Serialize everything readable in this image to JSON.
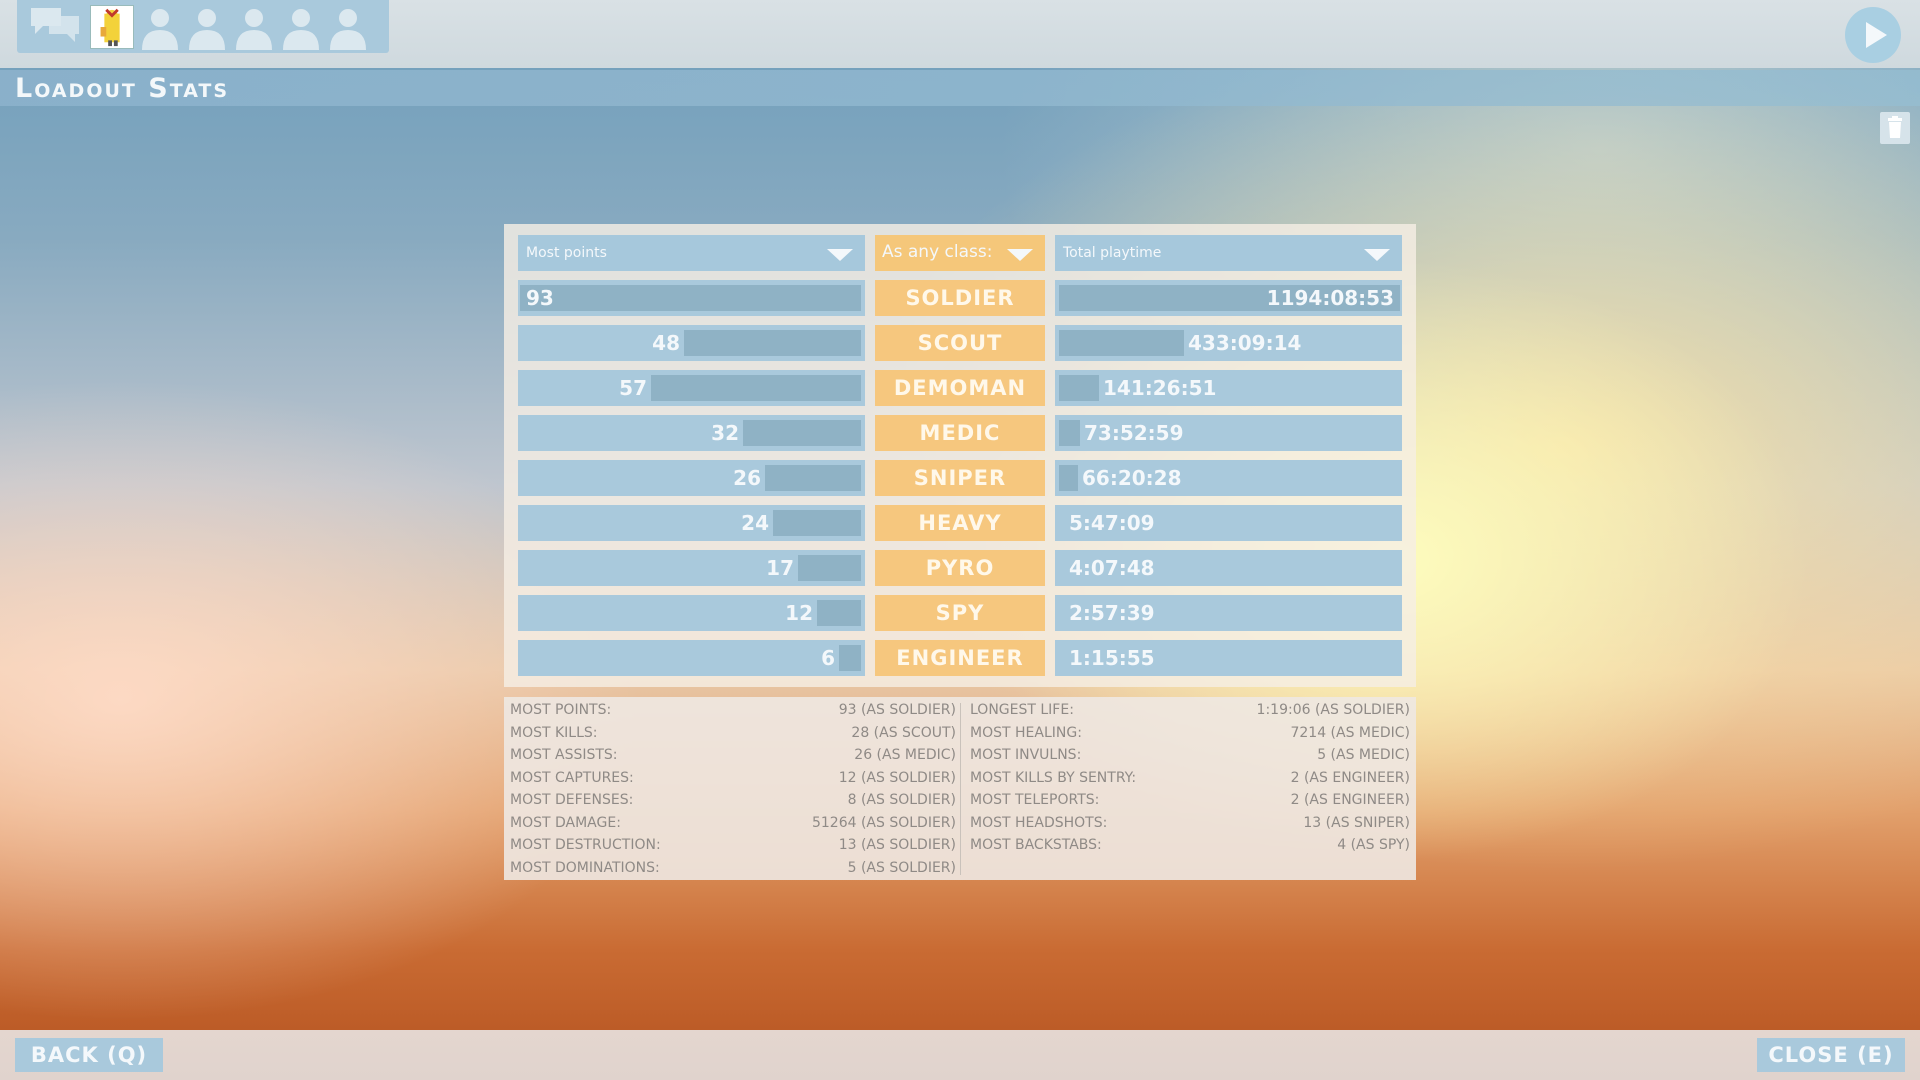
{
  "header": {
    "title": "Loadout Stats",
    "icons": [
      "chat-icon",
      "player-avatar",
      "empty-party-slot-icon",
      "play-icon",
      "trash-icon"
    ]
  },
  "filters": {
    "left_metric": "Most points",
    "class_filter": "As any class:",
    "right_metric": "Total playtime"
  },
  "classes": [
    {
      "name": "SOLDIER",
      "points": "93",
      "points_fraction": 1.0,
      "playtime": "1194:08:53",
      "playtime_fraction": 1.0
    },
    {
      "name": "SCOUT",
      "points": "48",
      "points_fraction": 0.516,
      "playtime": "433:09:14",
      "playtime_fraction": 0.363
    },
    {
      "name": "DEMOMAN",
      "points": "57",
      "points_fraction": 0.613,
      "playtime": "141:26:51",
      "playtime_fraction": 0.118
    },
    {
      "name": "MEDIC",
      "points": "32",
      "points_fraction": 0.344,
      "playtime": "73:52:59",
      "playtime_fraction": 0.062
    },
    {
      "name": "SNIPER",
      "points": "26",
      "points_fraction": 0.28,
      "playtime": "66:20:28",
      "playtime_fraction": 0.056
    },
    {
      "name": "HEAVY",
      "points": "24",
      "points_fraction": 0.258,
      "playtime": "5:47:09",
      "playtime_fraction": 0.005
    },
    {
      "name": "PYRO",
      "points": "17",
      "points_fraction": 0.183,
      "playtime": "4:07:48",
      "playtime_fraction": 0.003
    },
    {
      "name": "SPY",
      "points": "12",
      "points_fraction": 0.129,
      "playtime": "2:57:39",
      "playtime_fraction": 0.002
    },
    {
      "name": "ENGINEER",
      "points": "6",
      "points_fraction": 0.065,
      "playtime": "1:15:55",
      "playtime_fraction": 0.001
    }
  ],
  "records_left": [
    {
      "label": "MOST POINTS:",
      "value": "93 (AS SOLDIER)"
    },
    {
      "label": "MOST KILLS:",
      "value": "28 (AS SCOUT)"
    },
    {
      "label": "MOST ASSISTS:",
      "value": "26 (AS MEDIC)"
    },
    {
      "label": "MOST CAPTURES:",
      "value": "12 (AS SOLDIER)"
    },
    {
      "label": "MOST DEFENSES:",
      "value": "8 (AS SOLDIER)"
    },
    {
      "label": "MOST DAMAGE:",
      "value": "51264 (AS SOLDIER)"
    },
    {
      "label": "MOST DESTRUCTION:",
      "value": "13 (AS SOLDIER)"
    },
    {
      "label": "MOST DOMINATIONS:",
      "value": "5 (AS SOLDIER)"
    }
  ],
  "records_right": [
    {
      "label": "LONGEST LIFE:",
      "value": "1:19:06 (AS SOLDIER)"
    },
    {
      "label": "MOST HEALING:",
      "value": "7214 (AS MEDIC)"
    },
    {
      "label": "MOST INVULNS:",
      "value": "5 (AS MEDIC)"
    },
    {
      "label": "MOST KILLS BY SENTRY:",
      "value": "2 (AS ENGINEER)"
    },
    {
      "label": "MOST TELEPORTS:",
      "value": "2 (AS ENGINEER)"
    },
    {
      "label": "MOST HEADSHOTS:",
      "value": "13 (AS SNIPER)"
    },
    {
      "label": "MOST BACKSTABS:",
      "value": "4 (AS SPY)"
    }
  ],
  "footer": {
    "back_label": "BACK (Q)",
    "close_label": "CLOSE (E)"
  },
  "colors": {
    "panel_blue": "#a9c9dc",
    "class_orange": "#f6c77e",
    "bar_blue": "#8fb2c5"
  }
}
